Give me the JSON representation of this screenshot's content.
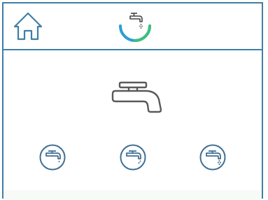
{
  "header": {
    "home_icon": "home-icon",
    "logo_icon": "faucet-logo-icon",
    "logo_arc_colors": [
      "#2a9fd6",
      "#3cbf7c"
    ]
  },
  "main": {
    "tap_icon": "faucet-icon",
    "modes": [
      {
        "icon": "faucet-mode-1-icon"
      },
      {
        "icon": "faucet-mode-2-icon"
      },
      {
        "icon": "faucet-mode-3-icon"
      }
    ]
  },
  "colors": {
    "frame": "#3f7fa6",
    "icon_stroke": "#5a5a5a",
    "mode_icon": "#3f6f93",
    "bottom_band": "#f6fbf8"
  }
}
